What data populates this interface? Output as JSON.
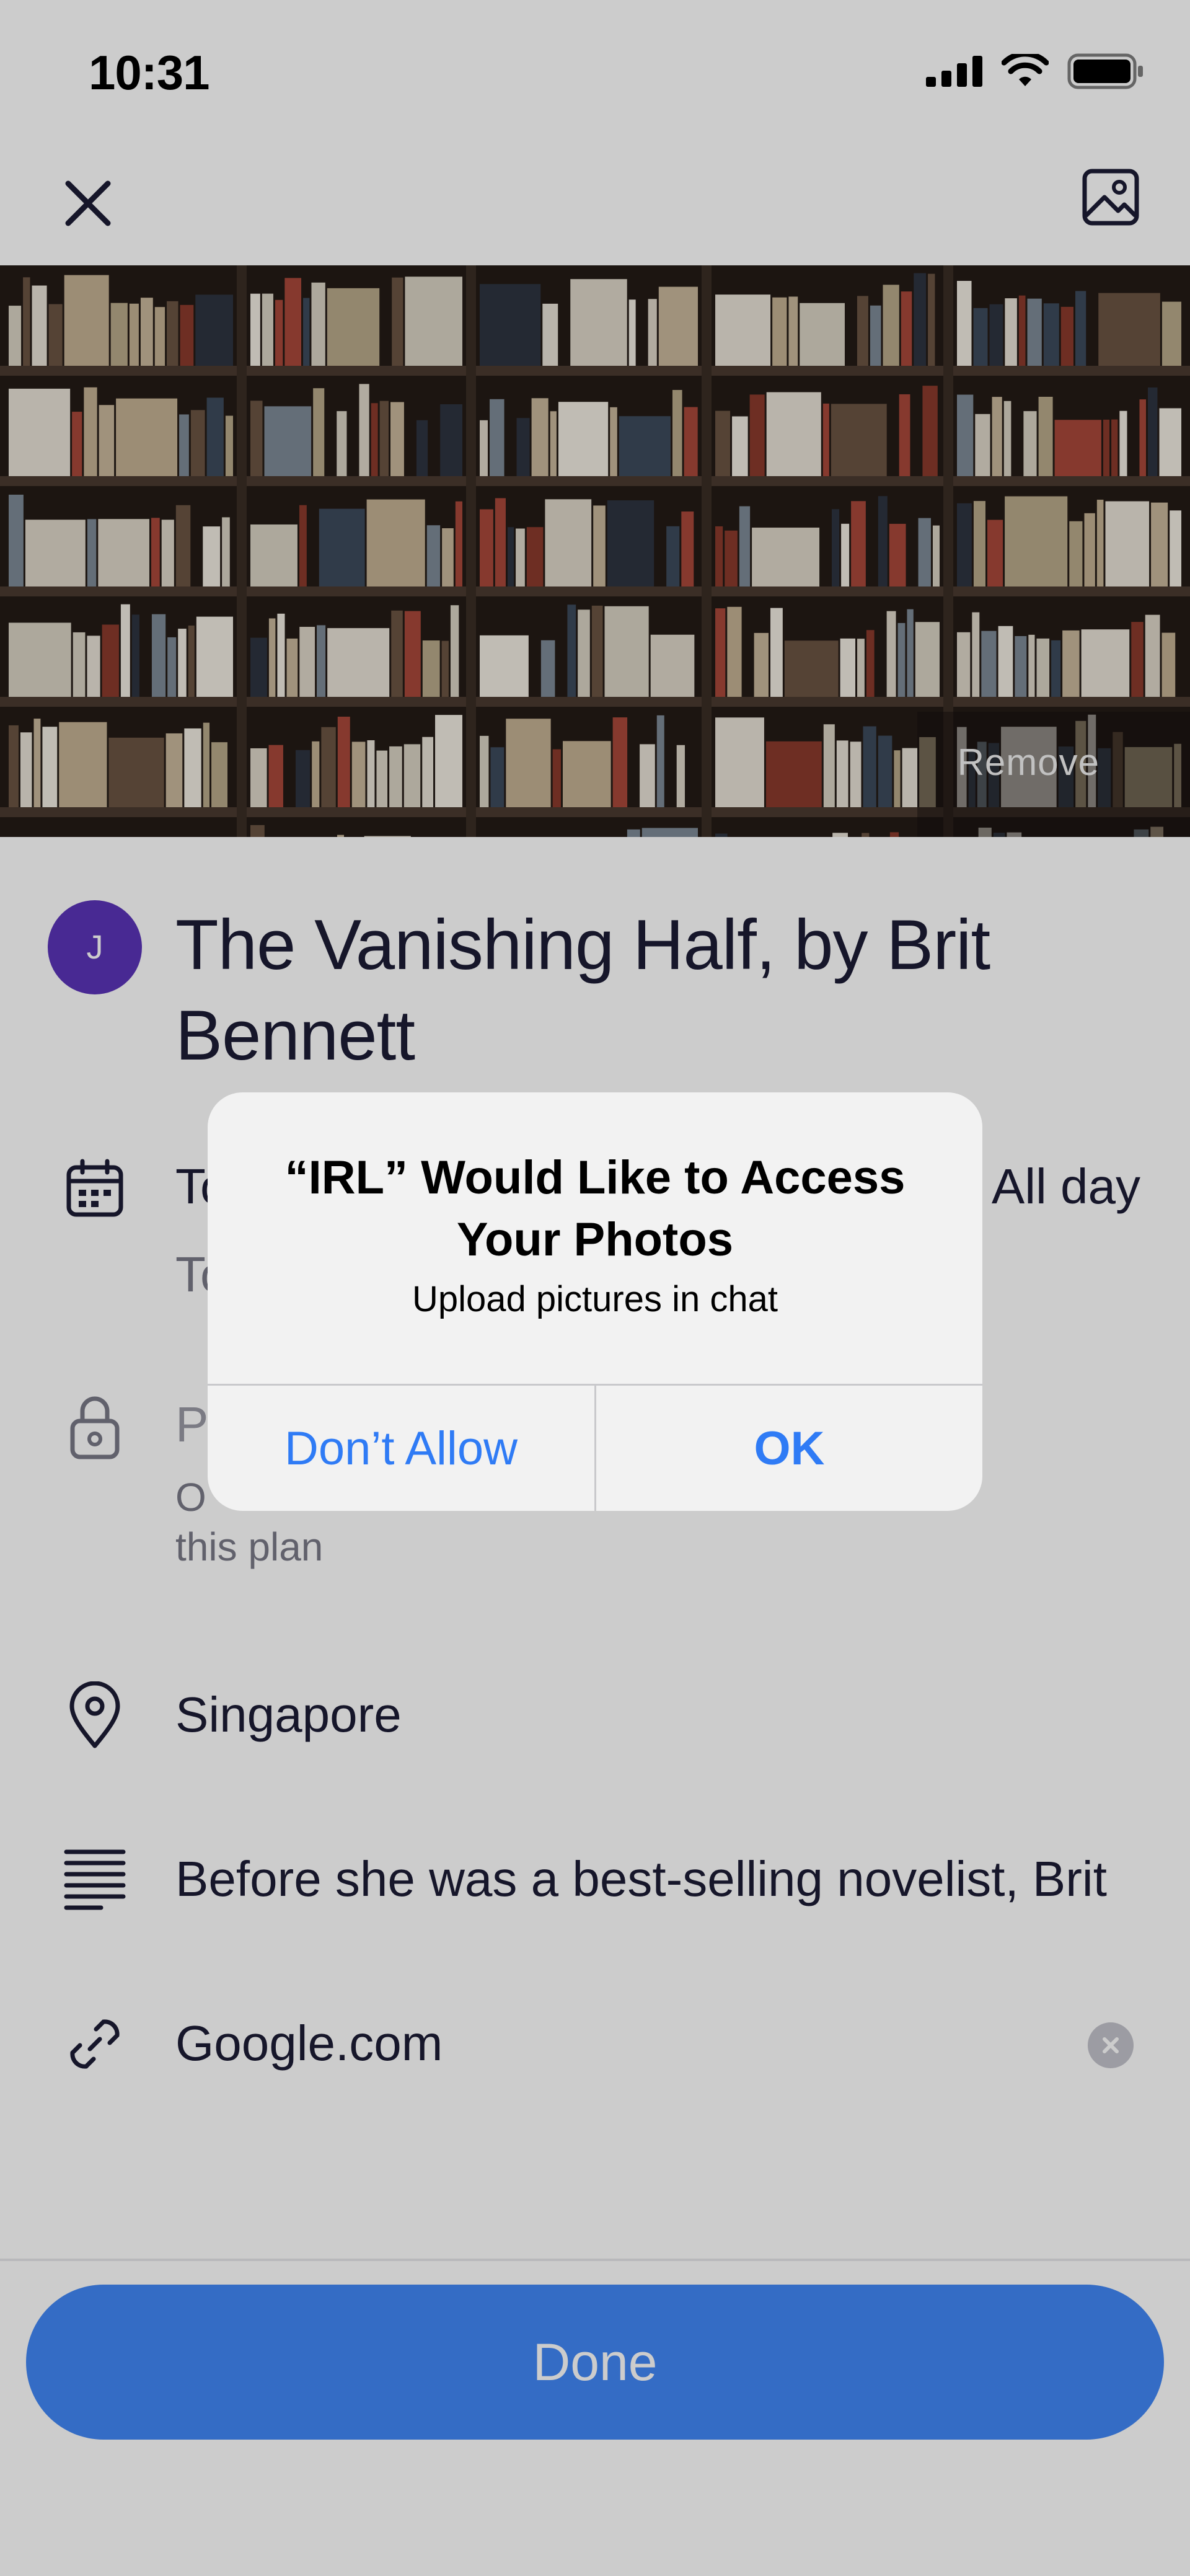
{
  "status_bar": {
    "time": "10:31"
  },
  "nav": {
    "close_icon": "close-icon",
    "image_icon": "image-icon"
  },
  "cover": {
    "remove_label": "Remove"
  },
  "event": {
    "avatar_initial": "J",
    "title": "The Vanishing Half, by Brit Bennett",
    "date_partial": "To",
    "time_partial": "To",
    "all_day_label": "All day",
    "privacy_partial": "P",
    "privacy_sub_partial": "O",
    "privacy_sub_line2": "this plan",
    "location": "Singapore",
    "description": "Before she was a best-selling novelist, Brit",
    "link": "Google.com"
  },
  "footer": {
    "done_label": "Done"
  },
  "alert": {
    "title": "“IRL” Would Like to Access Your Photos",
    "message": "Upload pictures in chat",
    "deny_label": "Don’t Allow",
    "ok_label": "OK",
    "button_color": "#2f7bf5"
  },
  "colors": {
    "accent": "#4187f7",
    "avatar": "#5b34b8"
  }
}
